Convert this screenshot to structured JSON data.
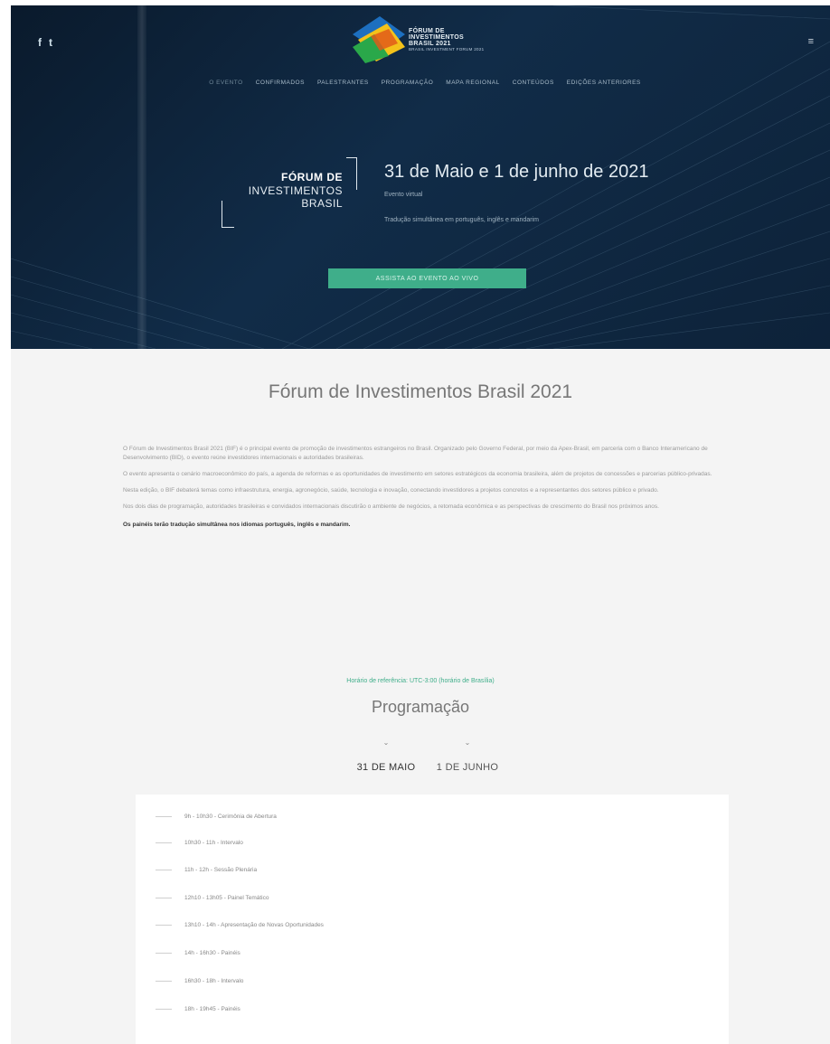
{
  "social": {
    "icons": [
      "facebook-icon",
      "twitter-icon"
    ],
    "facebook_glyph": "f",
    "twitter_glyph": "t"
  },
  "menu": {
    "glyph": "≡"
  },
  "brand": {
    "line1": "FÓRUM DE",
    "line2": "INVESTIMENTOS",
    "line3": "BRASIL 2021",
    "tagline": "BRASIL INVESTMENT FORUM 2021"
  },
  "nav": {
    "items": [
      "O EVENTO",
      "CONFIRMADOS",
      "PALESTRANTES",
      "PROGRAMAÇÃO",
      "MAPA REGIONAL",
      "CONTEÚDOS",
      "EDIÇÕES ANTERIORES"
    ]
  },
  "hero": {
    "logo_line1": "FÓRUM DE",
    "logo_line2": "INVESTIMENTOS",
    "logo_line3": "BRASIL",
    "date": "31 de Maio e 1 de junho de 2021",
    "format": "Evento virtual",
    "translation_note": "Tradução simultânea em português, inglês e mandarim",
    "cta_label": "ASSISTA AO EVENTO AO VIVO"
  },
  "about": {
    "title": "Fórum de Investimentos Brasil 2021",
    "paragraphs": [
      "O Fórum de Investimentos Brasil 2021 (BIF) é o principal evento de promoção de investimentos estrangeiros no Brasil. Organizado pelo Governo Federal, por meio da Apex-Brasil, em parceria com o Banco Interamericano de Desenvolvimento (BID), o evento reúne investidores internacionais e autoridades brasileiras.",
      "O evento apresenta o cenário macroeconômico do país, a agenda de reformas e as oportunidades de investimento em setores estratégicos da economia brasileira, além de projetos de concessões e parcerias público-privadas.",
      "Nesta edição, o BIF debaterá temas como infraestrutura, energia, agronegócio, saúde, tecnologia e inovação, conectando investidores a projetos concretos e a representantes dos setores público e privado.",
      "Nos dois dias de programação, autoridades brasileiras e convidados internacionais discutirão o ambiente de negócios, a retomada econômica e as perspectivas de crescimento do Brasil nos próximos anos."
    ],
    "bold_note": "Os painéis terão tradução simultânea nos idiomas português, inglês e mandarim."
  },
  "program": {
    "timezone_note": "Horário de referência: UTC-3:00 (horário de Brasília)",
    "title": "Programação",
    "tabs": [
      {
        "label": "31 DE MAIO",
        "chevron": "⌄"
      },
      {
        "label": "1 DE JUNHO",
        "chevron": "⌄"
      }
    ],
    "items": [
      "9h - 10h30 - Cerimônia de Abertura",
      "10h30 - 11h - Intervalo",
      "11h - 12h - Sessão Plenária",
      "12h10 - 13h05 - Painel Temático",
      "13h10 - 14h - Apresentação de Novas Oportunidades",
      "14h - 16h30 - Painéis",
      "16h30 - 18h - Intervalo",
      "18h - 19h45 - Painéis"
    ]
  },
  "colors": {
    "hero_bg": "#0d2239",
    "accent_green": "#3fae8a",
    "page_bg": "#f4f4f4"
  }
}
